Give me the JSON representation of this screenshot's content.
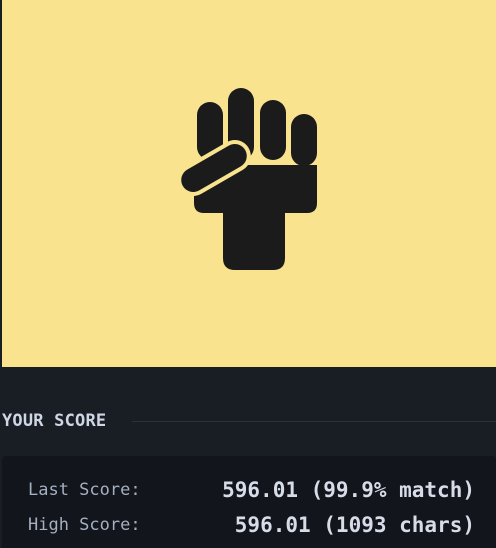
{
  "preview": {
    "background_color": "#f9e38f",
    "icon": "fist-icon",
    "icon_color": "#1b1b1b"
  },
  "score_section": {
    "title": "YOUR SCORE",
    "last_score_label": "Last Score:",
    "last_score_value": "596.01 (99.9% match)",
    "high_score_label": "High Score:",
    "high_score_value": "596.01 (1093 chars)"
  },
  "colors": {
    "page_background": "#191d24",
    "card_background": "#12151b",
    "label_text": "#a4afc0",
    "value_text": "#d7dde8"
  }
}
